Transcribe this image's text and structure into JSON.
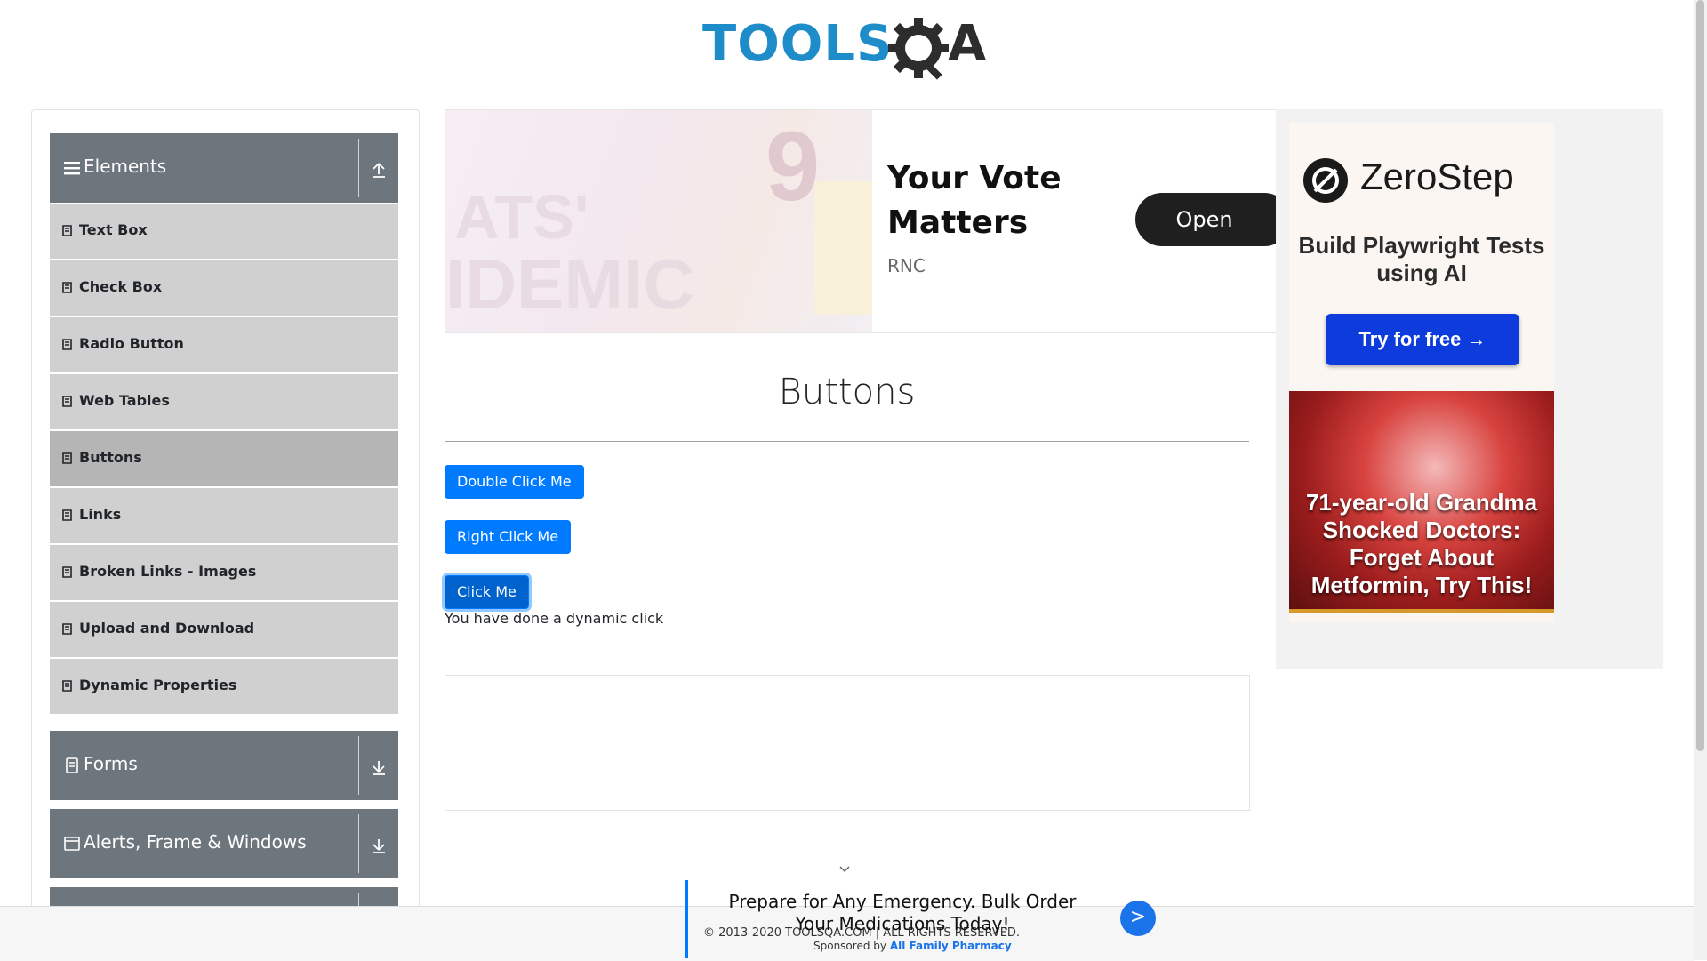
{
  "header": {
    "logo_text_tools": "TOOLS",
    "logo_text_qa": "QA"
  },
  "sidebar": {
    "groups": [
      {
        "title": "Elements",
        "icon": "hamburger-icon",
        "toggle": "collapse-up-icon"
      },
      {
        "title": "Forms",
        "icon": "form-icon",
        "toggle": "expand-down-icon"
      },
      {
        "title": "Alerts, Frame & Windows",
        "icon": "window-icon",
        "toggle": "expand-down-icon"
      }
    ],
    "items": [
      {
        "label": "Text Box"
      },
      {
        "label": "Check Box"
      },
      {
        "label": "Radio Button"
      },
      {
        "label": "Web Tables"
      },
      {
        "label": "Buttons",
        "active": true
      },
      {
        "label": "Links"
      },
      {
        "label": "Broken Links - Images"
      },
      {
        "label": "Upload and Download"
      },
      {
        "label": "Dynamic Properties"
      }
    ]
  },
  "ad_top": {
    "headline": "Your Vote Matters",
    "sponsor": "RNC",
    "cta": "Open"
  },
  "main": {
    "title": "Buttons",
    "buttons": {
      "double": "Double Click Me",
      "right": "Right Click Me",
      "click": "Click Me"
    },
    "message": "You have done a dynamic click"
  },
  "ad_right": {
    "brand": "ZeroStep",
    "tagline": "Build Playwright Tests using AI",
    "cta": "Try for free →",
    "caption": "71-year-old Grandma Shocked Doctors: Forget About Metformin, Try This!"
  },
  "bottom_ad": {
    "text": "Prepare for Any Emergency. Bulk Order Your Medications Today!",
    "sponsor_prefix": "Sponsored by",
    "sponsor_name": "All Family Pharmacy",
    "go": ">"
  },
  "footer": {
    "copyright": "© 2013-2020 TOOLSQA.COM | ALL RIGHTS RESERVED."
  },
  "colors": {
    "primary": "#007bff",
    "sidebar_header": "#6d757d",
    "sidebar_item": "#d0d0d0",
    "sidebar_active": "#b5b5b5",
    "logo_blue": "#1e8cc9"
  }
}
